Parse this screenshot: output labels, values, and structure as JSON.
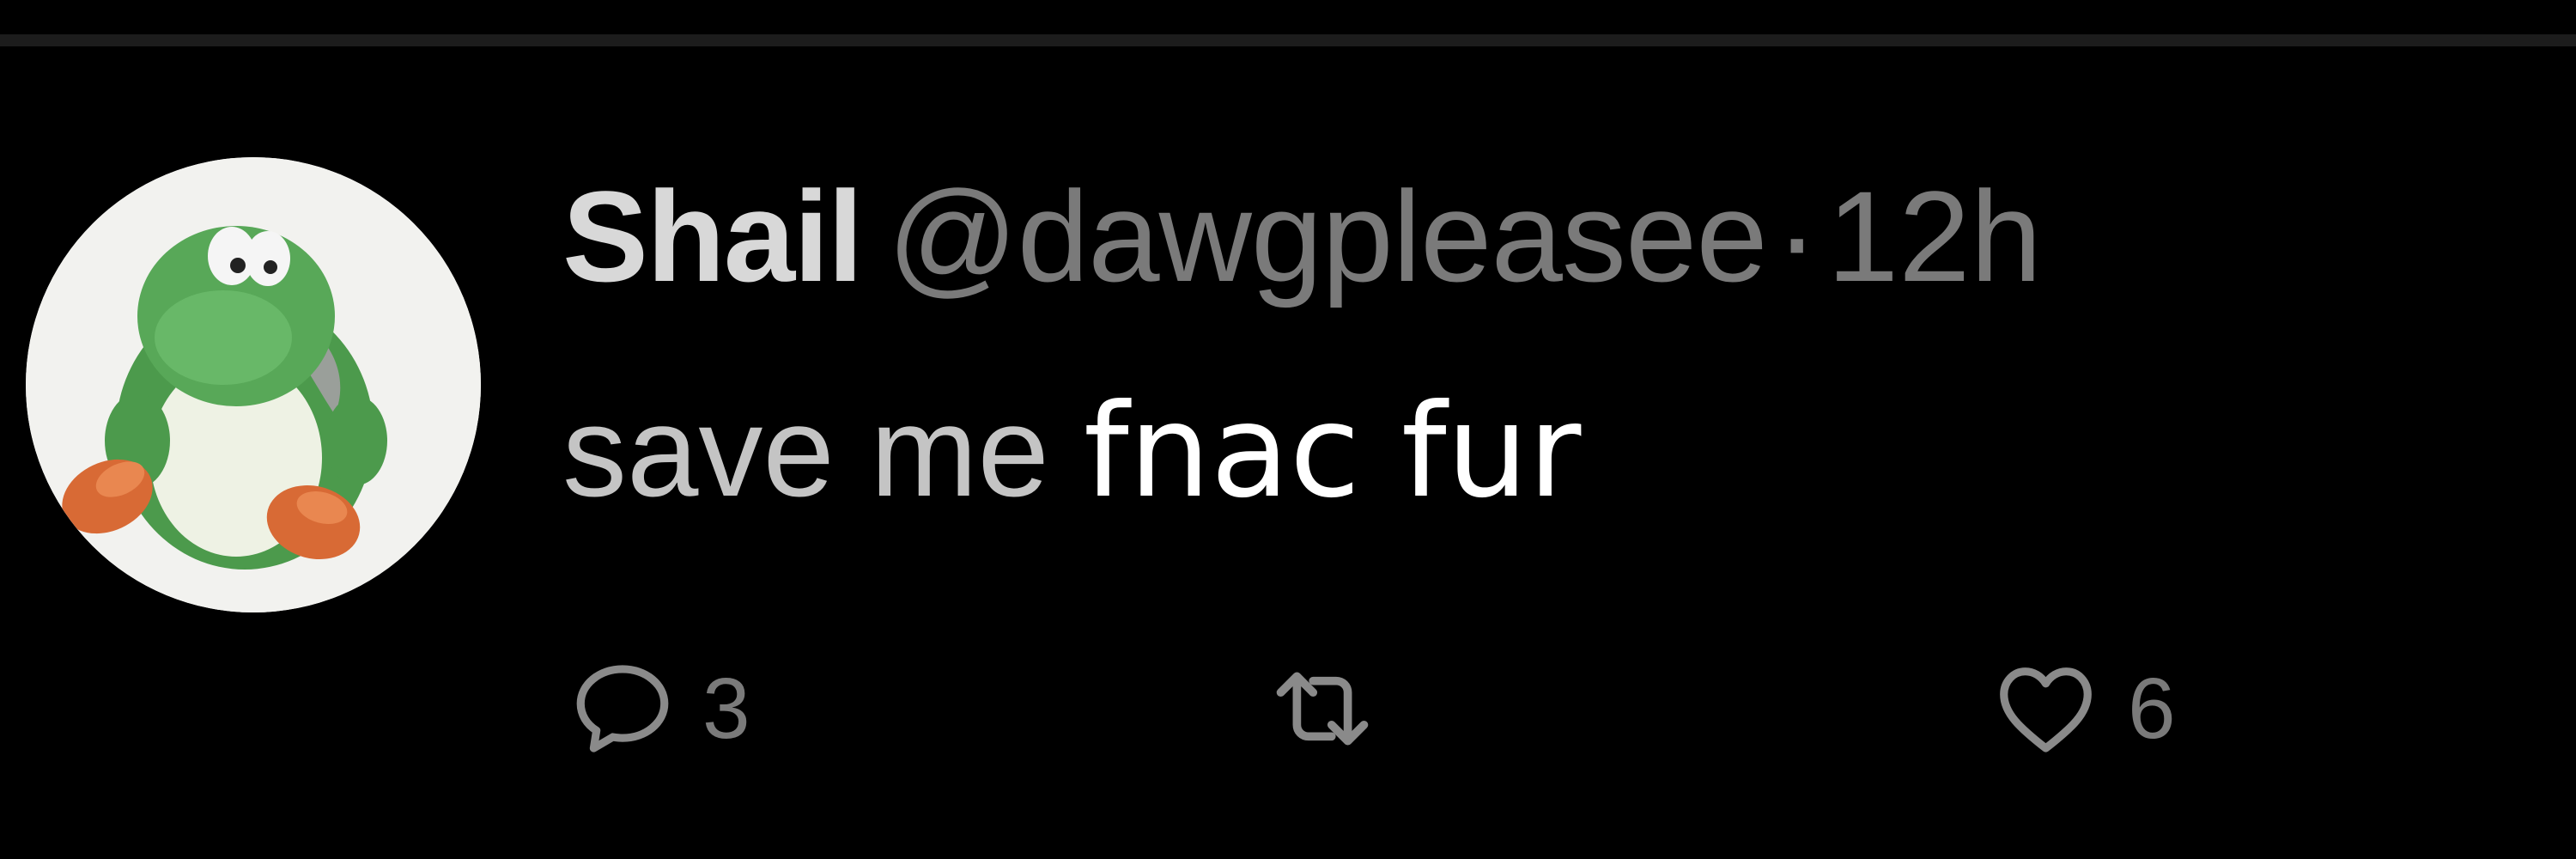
{
  "tweet": {
    "display_name": "Shail",
    "handle": "@dawgpleasee",
    "separator": "·",
    "timestamp": "12h",
    "text_part1": "save me",
    "text_part2": "fnac fur"
  },
  "actions": {
    "reply": {
      "icon": "reply-icon",
      "count": "3"
    },
    "retweet": {
      "icon": "retweet-icon",
      "count": ""
    },
    "like": {
      "icon": "heart-icon",
      "count": "6"
    }
  },
  "colors": {
    "background": "#000000",
    "name": "#d8d8d8",
    "secondary": "#7a7a7a",
    "body_gray": "#c4c4c4",
    "body_white": "#ffffff",
    "divider": "#1c1c1c"
  }
}
